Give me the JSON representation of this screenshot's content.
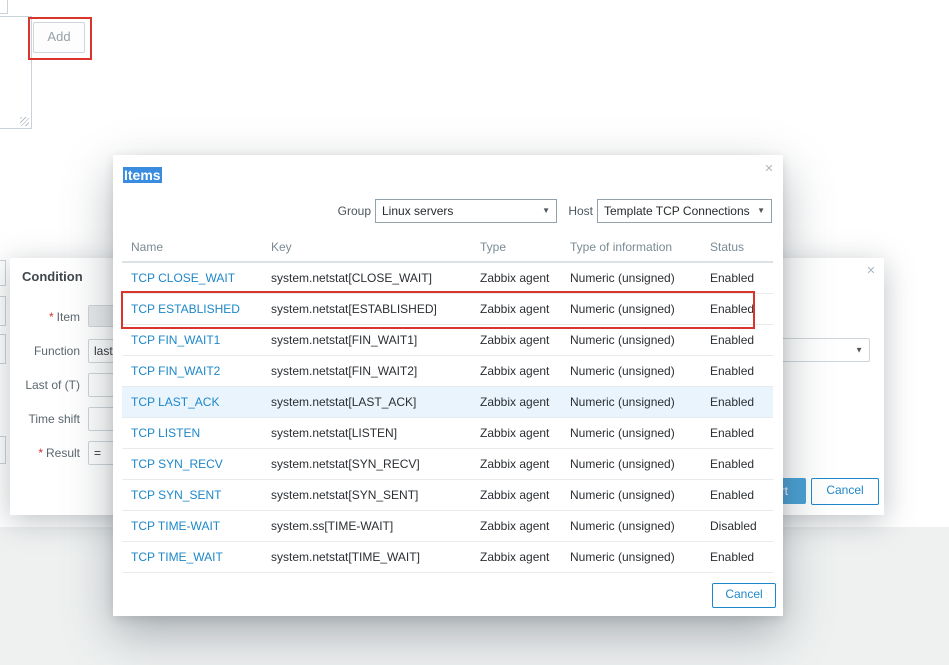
{
  "background": {
    "add_button_label": "Add"
  },
  "condition_dialog": {
    "title": "Condition",
    "close_icon": "✕",
    "fields": [
      {
        "prefix": "*",
        "label": "Item",
        "value": ""
      },
      {
        "prefix": "",
        "label": "Function",
        "value": "last"
      },
      {
        "prefix": "",
        "label": "Last of (T)",
        "value": ""
      },
      {
        "prefix": "",
        "label": "Time shift",
        "value": ""
      },
      {
        "prefix": "*",
        "label": "Result",
        "value": "="
      }
    ],
    "insert_label": "Insert",
    "cancel_label": "Cancel",
    "dropdown_caret": "▼"
  },
  "items_modal": {
    "title": "Items",
    "close_icon": "✕",
    "filters": {
      "group_label": "Group",
      "group_value": "Linux servers",
      "host_label": "Host",
      "host_value": "Template TCP Connections",
      "caret": "▼"
    },
    "table": {
      "columns": [
        "Name",
        "Key",
        "Type",
        "Type of information",
        "Status"
      ],
      "rows": [
        {
          "name": "TCP CLOSE_WAIT",
          "key": "system.netstat[CLOSE_WAIT]",
          "type": "Zabbix agent",
          "info": "Numeric (unsigned)",
          "status": "Enabled",
          "highlighted": false,
          "red_outline": false
        },
        {
          "name": "TCP ESTABLISHED",
          "key": "system.netstat[ESTABLISHED]",
          "type": "Zabbix agent",
          "info": "Numeric (unsigned)",
          "status": "Enabled",
          "highlighted": false,
          "red_outline": true
        },
        {
          "name": "TCP FIN_WAIT1",
          "key": "system.netstat[FIN_WAIT1]",
          "type": "Zabbix agent",
          "info": "Numeric (unsigned)",
          "status": "Enabled",
          "highlighted": false,
          "red_outline": false
        },
        {
          "name": "TCP FIN_WAIT2",
          "key": "system.netstat[FIN_WAIT2]",
          "type": "Zabbix agent",
          "info": "Numeric (unsigned)",
          "status": "Enabled",
          "highlighted": false,
          "red_outline": false
        },
        {
          "name": "TCP LAST_ACK",
          "key": "system.netstat[LAST_ACK]",
          "type": "Zabbix agent",
          "info": "Numeric (unsigned)",
          "status": "Enabled",
          "highlighted": true,
          "red_outline": false
        },
        {
          "name": "TCP LISTEN",
          "key": "system.netstat[LISTEN]",
          "type": "Zabbix agent",
          "info": "Numeric (unsigned)",
          "status": "Enabled",
          "highlighted": false,
          "red_outline": false
        },
        {
          "name": "TCP SYN_RECV",
          "key": "system.netstat[SYN_RECV]",
          "type": "Zabbix agent",
          "info": "Numeric (unsigned)",
          "status": "Enabled",
          "highlighted": false,
          "red_outline": false
        },
        {
          "name": "TCP SYN_SENT",
          "key": "system.netstat[SYN_SENT]",
          "type": "Zabbix agent",
          "info": "Numeric (unsigned)",
          "status": "Enabled",
          "highlighted": false,
          "red_outline": false
        },
        {
          "name": "TCP TIME-WAIT",
          "key": "system.ss[TIME-WAIT]",
          "type": "Zabbix agent",
          "info": "Numeric (unsigned)",
          "status": "Disabled",
          "highlighted": false,
          "red_outline": false
        },
        {
          "name": "TCP TIME_WAIT",
          "key": "system.netstat[TIME_WAIT]",
          "type": "Zabbix agent",
          "info": "Numeric (unsigned)",
          "status": "Enabled",
          "highlighted": false,
          "red_outline": false
        }
      ]
    },
    "cancel_label": "Cancel"
  },
  "colors": {
    "selection_blue": "#3a8ce0",
    "link_blue": "#1d87c9",
    "enabled_green": "#3ea03e",
    "disabled_red": "#df3f35",
    "annotation_red": "#da352c",
    "primary_button_blue": "#459fd4",
    "page_footer_gray": "#eff1f1"
  }
}
